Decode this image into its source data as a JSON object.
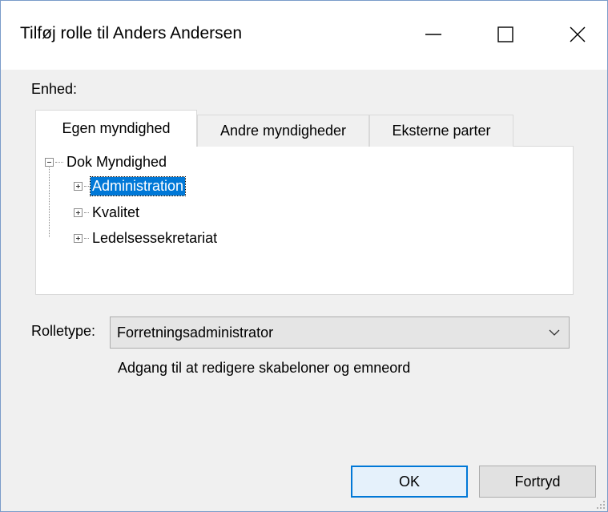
{
  "window": {
    "title": "Tilføj rolle til Anders Andersen"
  },
  "form": {
    "unit_label": "Enhed:",
    "tabs": [
      {
        "label": "Egen myndighed",
        "selected": true
      },
      {
        "label": "Andre myndigheder",
        "selected": false
      },
      {
        "label": "Eksterne parter",
        "selected": false
      }
    ],
    "tree": {
      "root": {
        "label": "Dok Myndighed",
        "expanded": true
      },
      "children": [
        {
          "label": "Administration",
          "selected": true,
          "expanded": false
        },
        {
          "label": "Kvalitet",
          "selected": false,
          "expanded": false
        },
        {
          "label": "Ledelsessekretariat",
          "selected": false,
          "expanded": false
        }
      ]
    },
    "role_type_label": "Rolletype:",
    "role_type_value": "Forretningsadministrator",
    "role_description": "Adgang til at redigere skabeloner og emneord"
  },
  "buttons": {
    "ok": "OK",
    "cancel": "Fortryd"
  },
  "colors": {
    "selection": "#0078d7",
    "default_button_border": "#0078d7"
  },
  "icons": {
    "minimize": "minimize-icon",
    "maximize": "maximize-icon",
    "close": "close-icon",
    "dropdown": "chevron-down-icon"
  }
}
